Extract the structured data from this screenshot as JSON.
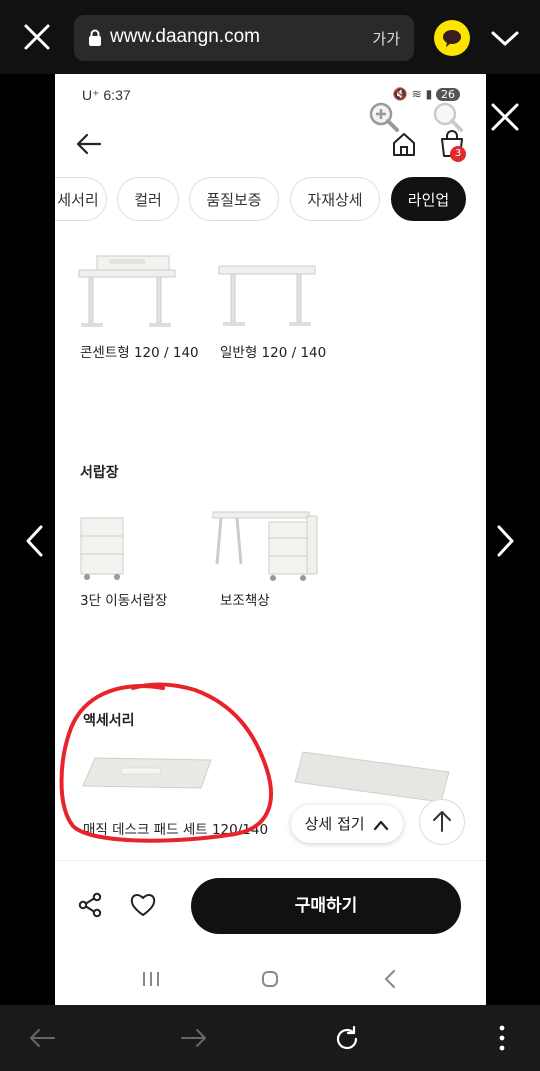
{
  "browser": {
    "url": "www.daangn.com",
    "text_size_label": "가가"
  },
  "status": {
    "carrier_time": "U⁺ 6:37",
    "battery": "26"
  },
  "cart": {
    "badge_count": "3"
  },
  "tabs": [
    {
      "label": "세서리",
      "active": false
    },
    {
      "label": "컬러",
      "active": false
    },
    {
      "label": "품질보증",
      "active": false
    },
    {
      "label": "자재상세",
      "active": false
    },
    {
      "label": "라인업",
      "active": true
    }
  ],
  "desks": {
    "items": [
      {
        "label": "콘센트형 120 / 140"
      },
      {
        "label": "일반형 120 / 140"
      }
    ]
  },
  "drawers": {
    "title": "서랍장",
    "items": [
      {
        "label": "3단 이동서랍장"
      },
      {
        "label": "보조책상"
      }
    ]
  },
  "accessories": {
    "title": "액세서리",
    "items": [
      {
        "label": "매직 데스크 패드 세트 120/140"
      }
    ]
  },
  "actions": {
    "collapse_label": "상세 접기",
    "buy_label": "구매하기"
  },
  "colors": {
    "annotation_red": "#e8232a",
    "buy_button": "#111111",
    "kakao_yellow": "#fee500",
    "badge_red": "#e02b2b"
  }
}
